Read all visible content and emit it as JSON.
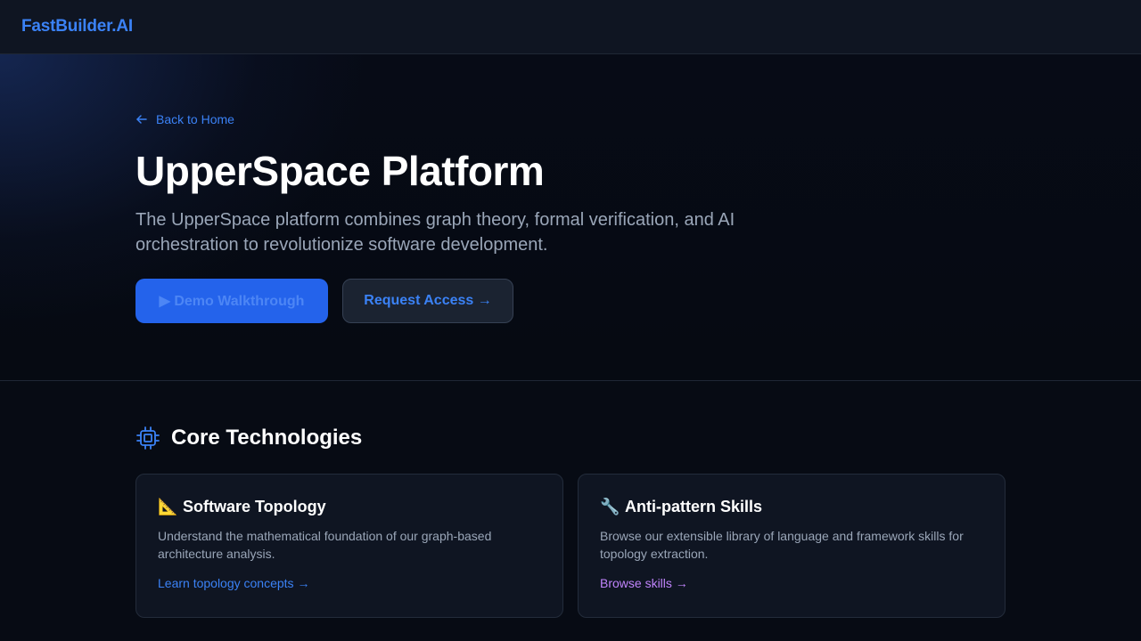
{
  "header": {
    "brand": "FastBuilder.AI"
  },
  "hero": {
    "back_link": "Back to Home",
    "title": "UpperSpace Platform",
    "subtitle": "The UpperSpace platform combines graph theory, formal verification, and AI orchestration to revolutionize software development.",
    "primary_button": "▶ Demo Walkthrough",
    "secondary_button": "Request Access →"
  },
  "section": {
    "icon": "cpu-chip-icon",
    "title": "Core Technologies"
  },
  "cards": [
    {
      "emoji": "📐",
      "icon": "triangular-ruler-icon",
      "title": "Software Topology",
      "description": "Understand the mathematical foundation of our graph-based architecture analysis.",
      "link": "Learn topology concepts →"
    },
    {
      "emoji": "🔧",
      "icon": "wrench-icon",
      "title": "Anti-pattern Skills",
      "description": "Browse our extensible library of language and framework skills for topology extraction.",
      "link": "Browse skills →"
    }
  ],
  "colors": {
    "accent_blue": "#3b82f6",
    "primary_button": "#2463eb",
    "link_purple": "#c084fc",
    "background": "#070b14",
    "card_background": "#0f1522"
  }
}
